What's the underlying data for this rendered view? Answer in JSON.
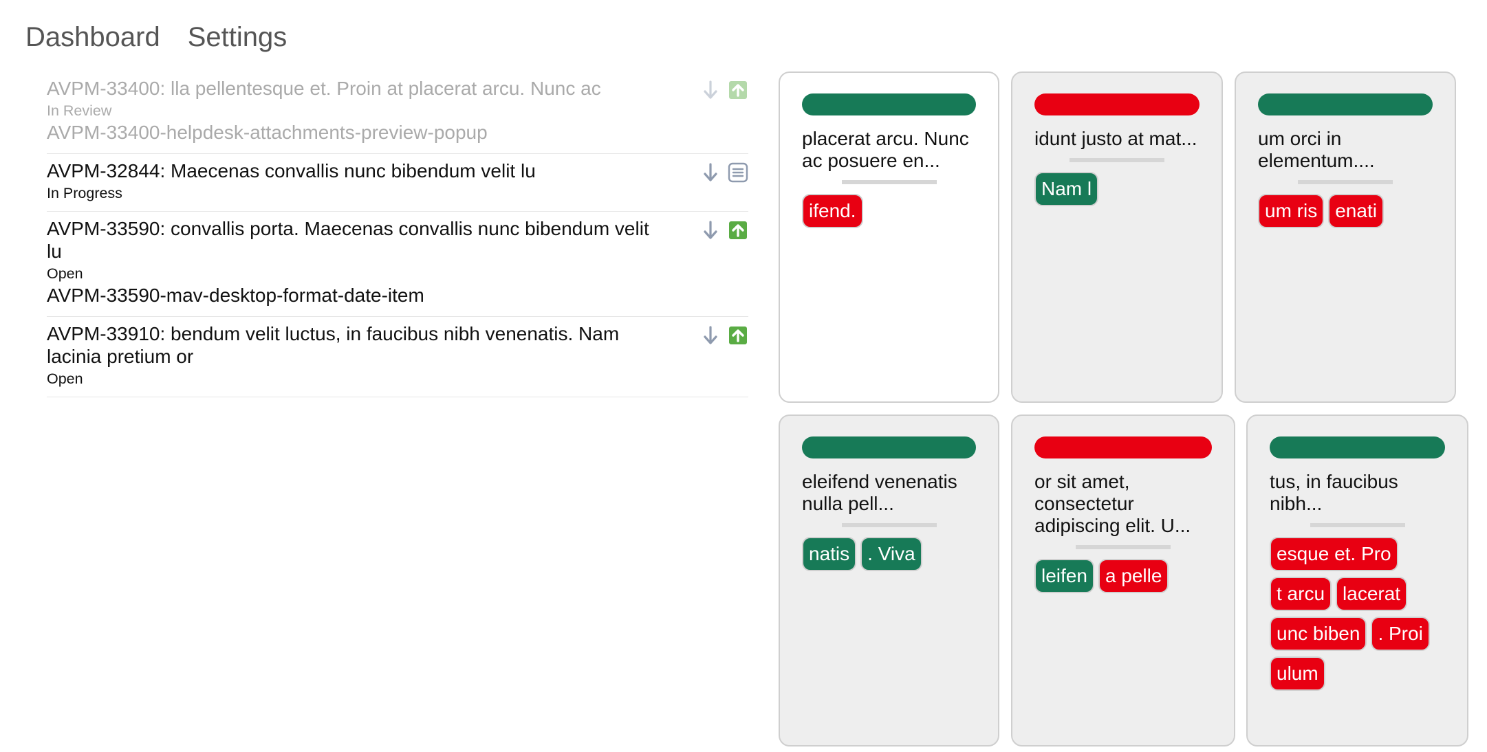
{
  "nav": {
    "dashboard": "Dashboard",
    "settings": "Settings"
  },
  "colors": {
    "green": "#177a57",
    "red": "#e80012",
    "card_grey": "#eeeeee"
  },
  "list": [
    {
      "title": "AVPM-33400: lla pellentesque et. Proin at placerat arcu. Nunc ac",
      "status": "In Review",
      "branch": "AVPM-33400-helpdesk-attachments-preview-popup",
      "faded": true,
      "action_icon": "upload-icon"
    },
    {
      "title": "AVPM-32844: Maecenas convallis nunc bibendum velit lu",
      "status": "In Progress",
      "branch": "",
      "faded": false,
      "action_icon": "list-icon"
    },
    {
      "title": "AVPM-33590: convallis porta. Maecenas convallis nunc bibendum velit lu",
      "status": "Open",
      "branch": "AVPM-33590-mav-desktop-format-date-item",
      "faded": false,
      "action_icon": "upload-icon"
    },
    {
      "title": "AVPM-33910: bendum velit luctus, in faucibus nibh venenatis. Nam lacinia pretium or",
      "status": "Open",
      "branch": "",
      "faded": false,
      "action_icon": "upload-icon"
    }
  ],
  "cards": [
    {
      "bar": "green",
      "text": "placerat arcu. Nunc ac posuere en...",
      "tags": [
        {
          "label": "ifend.",
          "color": "red"
        }
      ]
    },
    {
      "bar": "red",
      "text": "idunt justo at mat...",
      "tags": [
        {
          "label": "Nam l",
          "color": "green"
        }
      ]
    },
    {
      "bar": "green",
      "text": "um orci in elementum....",
      "tags": [
        {
          "label": "um ris",
          "color": "red"
        },
        {
          "label": "enati",
          "color": "red"
        }
      ]
    },
    {
      "bar": "green",
      "text": "eleifend venenatis nulla pell...",
      "tags": [
        {
          "label": "natis",
          "color": "green"
        },
        {
          "label": ". Viva",
          "color": "green"
        }
      ]
    },
    {
      "bar": "red",
      "text": "or sit amet, consectetur adipiscing elit. U...",
      "tags": [
        {
          "label": "leifen",
          "color": "green"
        },
        {
          "label": "a pelle",
          "color": "red"
        }
      ]
    },
    {
      "bar": "green",
      "text": "tus, in faucibus nibh...",
      "tags": [
        {
          "label": "esque et. Pro",
          "color": "red"
        },
        {
          "label": "t arcu",
          "color": "red"
        },
        {
          "label": "lacerat",
          "color": "red"
        },
        {
          "label": "unc biben",
          "color": "red"
        },
        {
          "label": ". Proi",
          "color": "red"
        },
        {
          "label": "ulum",
          "color": "red"
        }
      ]
    }
  ]
}
